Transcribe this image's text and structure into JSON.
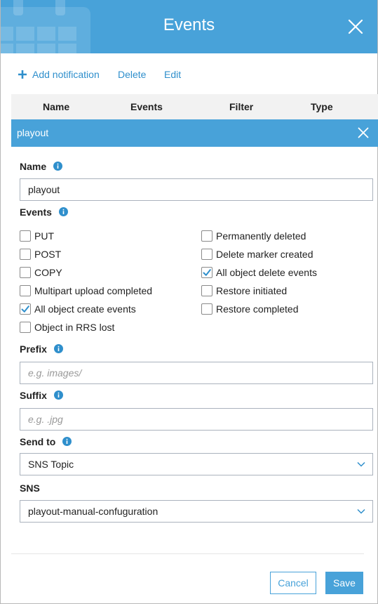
{
  "header": {
    "title": "Events"
  },
  "toolbar": {
    "add_label": "Add notification",
    "delete_label": "Delete",
    "edit_label": "Edit"
  },
  "table": {
    "columns": [
      "Name",
      "Events",
      "Filter",
      "Type"
    ]
  },
  "selected": {
    "name": "playout"
  },
  "form": {
    "name_label": "Name",
    "name_value": "playout",
    "events_label": "Events",
    "events_left": [
      {
        "label": "PUT",
        "checked": false
      },
      {
        "label": "POST",
        "checked": false
      },
      {
        "label": "COPY",
        "checked": false
      },
      {
        "label": "Multipart upload completed",
        "checked": false
      },
      {
        "label": "All object create events",
        "checked": true
      },
      {
        "label": "Object in RRS lost",
        "checked": false
      }
    ],
    "events_right": [
      {
        "label": "Permanently deleted",
        "checked": false
      },
      {
        "label": "Delete marker created",
        "checked": false
      },
      {
        "label": "All object delete events",
        "checked": true
      },
      {
        "label": "Restore initiated",
        "checked": false
      },
      {
        "label": "Restore completed",
        "checked": false
      }
    ],
    "prefix_label": "Prefix",
    "prefix_placeholder": "e.g. images/",
    "suffix_label": "Suffix",
    "suffix_placeholder": "e.g. .jpg",
    "sendto_label": "Send to",
    "sendto_value": "SNS Topic",
    "sns_label": "SNS",
    "sns_value": "playout-manual-confuguration"
  },
  "buttons": {
    "cancel": "Cancel",
    "save": "Save"
  },
  "colors": {
    "accent": "#48a2d9",
    "link": "#2f8fcc",
    "check": "#2f8fcc"
  }
}
